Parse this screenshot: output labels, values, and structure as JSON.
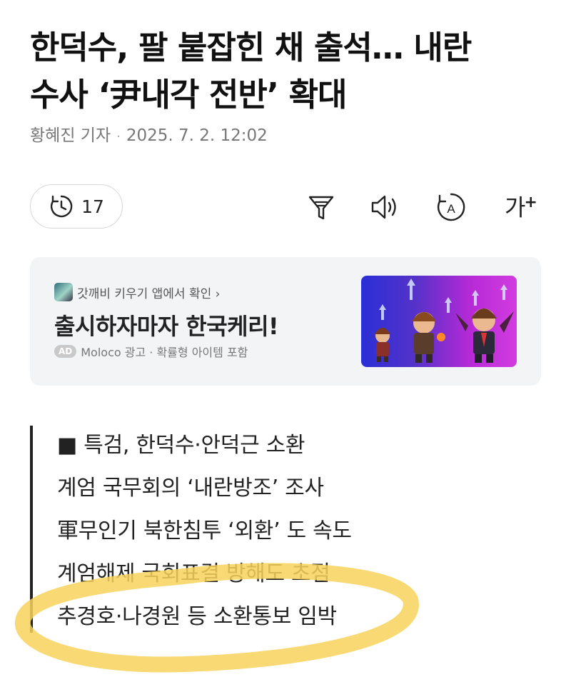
{
  "article": {
    "headline_line1": "한덕수, 팔 붙잡힌 채 출석… 내란",
    "headline_line2": "수사 ‘尹내각 전반’ 확대",
    "author": "황혜진 기자",
    "datetime": "2025. 7. 2. 12:02"
  },
  "toolbar": {
    "comment_count": "17",
    "icons": [
      "clock-icon",
      "filter-icon",
      "speaker-icon",
      "translate-icon",
      "font-size-icon"
    ],
    "font_size_label": "가",
    "font_size_sup": "+"
  },
  "ad": {
    "source": "갓깨비 키우기 앱에서 확인 ›",
    "title": "출시하자마자 한국케리!",
    "badge": "AD",
    "advertiser": "Moloco 광고 · 확률형 아이템 포함"
  },
  "summary": {
    "lines": [
      "■ 특검, 한덕수·안덕근 소환",
      "계엄 국무회의 ‘내란방조’ 조사",
      "軍무인기 북한침투 ‘외환’ 도 속도",
      "계엄해제 국회표결 방해도 초점",
      "추경호·나경원 등 소환통보 임박"
    ]
  },
  "colors": {
    "highlight": "#f7d25a",
    "ad_background": "#f3f4f5"
  }
}
